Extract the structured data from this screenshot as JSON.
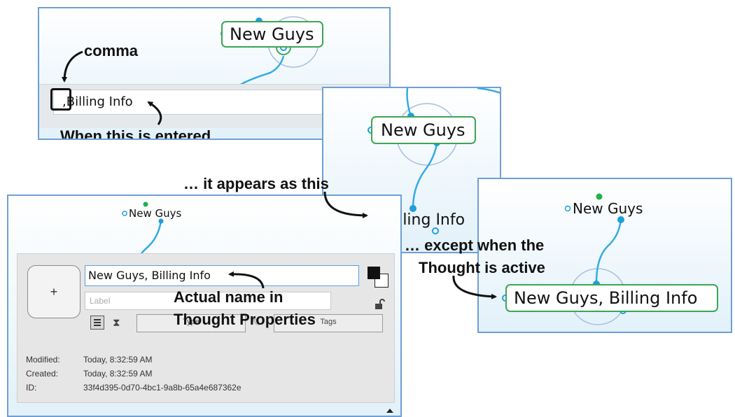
{
  "panel1": {
    "thought_name": "New Guys",
    "input_value": ",Billing Info"
  },
  "panel2": {
    "thought_parent": "New Guys",
    "thought_child": "Billing Info"
  },
  "panel3": {
    "thought_parent": "New Guys",
    "thought_active": "New Guys, Billing Info"
  },
  "properties": {
    "thought_name": "New Guys",
    "name_value": "New Guys, Billing Info",
    "label_placeholder": "Label",
    "add_image_label": "+",
    "type_label": "Type",
    "tags_label": "Tags",
    "modified_label": "Modified:",
    "modified_value": "Today, 8:32:59 AM",
    "created_label": "Created:",
    "created_value": "Today, 8:32:59 AM",
    "id_label": "ID:",
    "id_value": "33f4d395-0d70-4bc1-9a8b-65a4e687362e"
  },
  "annotations": {
    "comma": "comma",
    "when_entered": "When this is entered …",
    "appears_as": "… it appears as this",
    "except_when": "… except when the",
    "thought_active": "Thought is active",
    "actual_name": "Actual name in",
    "thought_properties": "Thought Properties"
  },
  "colors": {
    "link": "#34ace0",
    "node": "#1e9fdc",
    "selection_border": "#3aa655",
    "active_dot": "#22b14c",
    "panel_border": "#6e9fd4"
  }
}
